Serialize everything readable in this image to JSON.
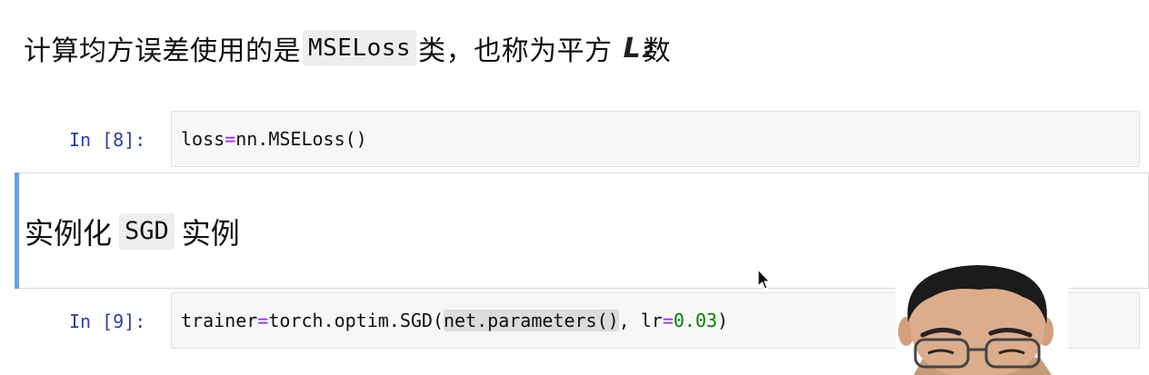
{
  "markdown_1": {
    "before_code": "计算均方误差使用的是",
    "code": "MSELoss",
    "after_code": "类，也称为平方",
    "cursor_glyph": "L₂",
    "tail": "数"
  },
  "cell_8": {
    "prompt": "In [8]:",
    "code": {
      "var": "loss",
      "op": "=",
      "call": "nn.MSELoss()"
    }
  },
  "markdown_2": {
    "before_code": "实例化",
    "code": "SGD",
    "after_code": "实例"
  },
  "cell_9": {
    "prompt": "In [9]:",
    "code": {
      "var": "trainer",
      "op1": "=",
      "call_start": "torch.optim.SGD(",
      "highlighted": "net.parameters()",
      "comma": ", lr",
      "op2": "=",
      "number": "0.03",
      "close": ")"
    }
  },
  "icons": [
    "mouse-pointer-icon",
    "presenter-webcam"
  ],
  "colors": {
    "prompt": "#303f9f",
    "operator": "#aa22ff",
    "number": "#008000",
    "selected_bar": "#66a3e0",
    "cell_bg": "#f7f7f7"
  }
}
